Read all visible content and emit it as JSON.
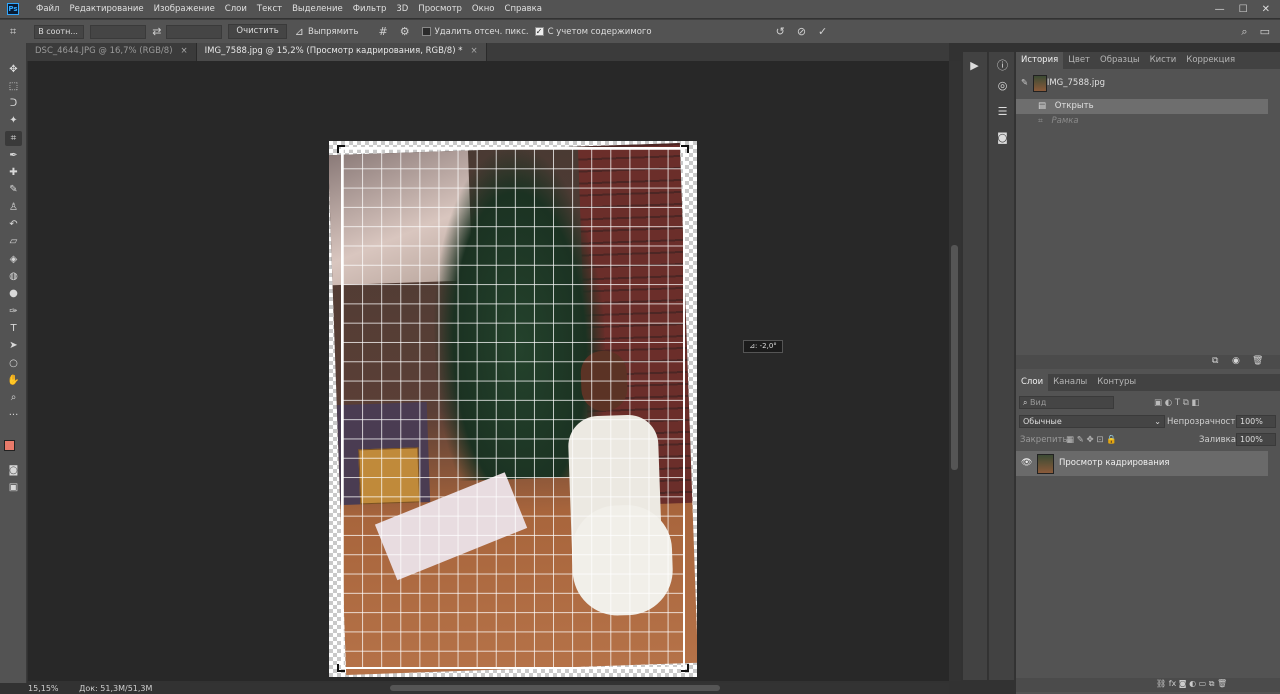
{
  "app": {
    "logo": "Ps"
  },
  "menu": [
    "Файл",
    "Редактирование",
    "Изображение",
    "Слои",
    "Текст",
    "Выделение",
    "Фильтр",
    "3D",
    "Просмотр",
    "Окно",
    "Справка"
  ],
  "window_controls": {
    "minimize": "—",
    "maximize": "☐",
    "close": "✕"
  },
  "options": {
    "ratio_preset": "В соотн...",
    "ratio_w": "",
    "ratio_h": "",
    "clear_label": "Очистить",
    "straighten_label": "Выпрямить",
    "delete_cropped_label": "Удалить отсеч. пикс.",
    "delete_cropped_checked": false,
    "content_aware_label": "С учетом содержимого",
    "content_aware_checked": true
  },
  "tabs": [
    {
      "label": "DSC_4644.JPG @ 16,7% (RGB/8)",
      "close": "×",
      "active": false
    },
    {
      "label": "IMG_7588.jpg @ 15,2% (Просмотр кадрирования, RGB/8) *",
      "close": "×",
      "active": true
    }
  ],
  "canvas": {
    "angle_readout": "⊿: -2,0°"
  },
  "status": {
    "zoom": "15,15%",
    "doc_size": "Док: 51,3M/51,3M"
  },
  "history_panel": {
    "tabs": [
      "История",
      "Цвет",
      "Образцы",
      "Кисти",
      "Коррекция"
    ],
    "snapshot": "IMG_7588.jpg",
    "steps": [
      {
        "label": "Открыть",
        "active": true
      },
      {
        "label": "Рамка",
        "active": false
      }
    ]
  },
  "layers_panel": {
    "tabs": [
      "Слои",
      "Каналы",
      "Контуры"
    ],
    "search_placeholder": "Вид",
    "blend_mode": "Обычные",
    "opacity_label": "Непрозрачность:",
    "opacity_value": "100%",
    "lock_label": "Закрепить:",
    "fill_label": "Заливка:",
    "fill_value": "100%",
    "layer_name": "Просмотр кадрирования"
  },
  "colors": {
    "foreground": "#e87a6a",
    "background": "#ffffff",
    "accent": "#31a8ff"
  }
}
